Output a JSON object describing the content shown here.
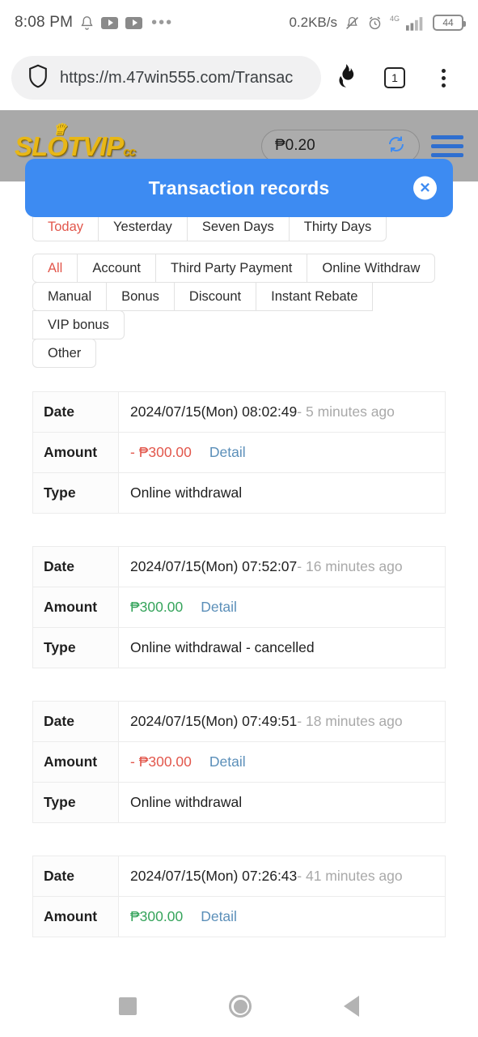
{
  "status_bar": {
    "time": "8:08 PM",
    "icons_left": [
      "bell-icon",
      "youtube-icon",
      "youtube-icon",
      "more-dots-icon"
    ],
    "network_speed": "0.2KB/s",
    "icons_right": [
      "mute-bell-icon",
      "alarm-clock-icon"
    ],
    "network_type": "4G",
    "battery_level": "44"
  },
  "browser": {
    "shield_icon": "shield-icon",
    "url": "https://m.47win555.com/Transac",
    "incognito_icon": "flame-icon",
    "tab_count": "1",
    "menu_icon": "kebab-menu-icon"
  },
  "site_header": {
    "logo_main": "SLOTVIP",
    "logo_suffix": "cc",
    "crown_icon": "crown-icon",
    "balance": "₱0.20",
    "refresh_icon": "refresh-icon",
    "menu_icon": "hamburger-icon"
  },
  "modal": {
    "title": "Transaction records",
    "close_icon": "close-icon",
    "close_label": "✕",
    "accent_color": "#3d8bf2"
  },
  "filters": {
    "period_tabs": [
      {
        "label": "Today",
        "active": true
      },
      {
        "label": "Yesterday",
        "active": false
      },
      {
        "label": "Seven Days",
        "active": false
      },
      {
        "label": "Thirty Days",
        "active": false
      }
    ],
    "category_tabs_row1": [
      {
        "label": "All",
        "active": true
      },
      {
        "label": "Account",
        "active": false
      },
      {
        "label": "Third Party Payment",
        "active": false
      },
      {
        "label": "Online Withdraw",
        "active": false
      }
    ],
    "category_tabs_row2": [
      {
        "label": "Manual",
        "active": false
      },
      {
        "label": "Bonus",
        "active": false
      },
      {
        "label": "Discount",
        "active": false
      },
      {
        "label": "Instant Rebate",
        "active": false
      },
      {
        "label": "VIP bonus",
        "active": false
      }
    ],
    "category_tabs_row3": [
      {
        "label": "Other",
        "active": false
      }
    ],
    "active_color": "#e2574c"
  },
  "table_labels": {
    "date": "Date",
    "amount": "Amount",
    "type": "Type",
    "detail": "Detail"
  },
  "records": [
    {
      "date": "2024/07/15(Mon) 08:02:49",
      "ago": "- 5 minutes ago",
      "amount": "- ₱300.00",
      "amount_sign": "negative",
      "detail": "Detail",
      "type": "Online withdrawal"
    },
    {
      "date": "2024/07/15(Mon) 07:52:07",
      "ago": "- 16 minutes ago",
      "amount": "₱300.00",
      "amount_sign": "positive",
      "detail": "Detail",
      "type": "Online withdrawal - cancelled"
    },
    {
      "date": "2024/07/15(Mon) 07:49:51",
      "ago": "- 18 minutes ago",
      "amount": "- ₱300.00",
      "amount_sign": "negative",
      "detail": "Detail",
      "type": "Online withdrawal"
    },
    {
      "date": "2024/07/15(Mon) 07:26:43",
      "ago": "- 41 minutes ago",
      "amount": "₱300.00",
      "amount_sign": "positive",
      "detail": "Detail",
      "type": ""
    }
  ],
  "nav_bar": {
    "recents_icon": "square-recents-icon",
    "home_icon": "circle-home-icon",
    "back_icon": "triangle-back-icon"
  },
  "colors": {
    "negative": "#e2574c",
    "positive": "#36a45c",
    "link": "#5b8fb9",
    "modal": "#3d8bf2",
    "logo": "#e8b716"
  }
}
